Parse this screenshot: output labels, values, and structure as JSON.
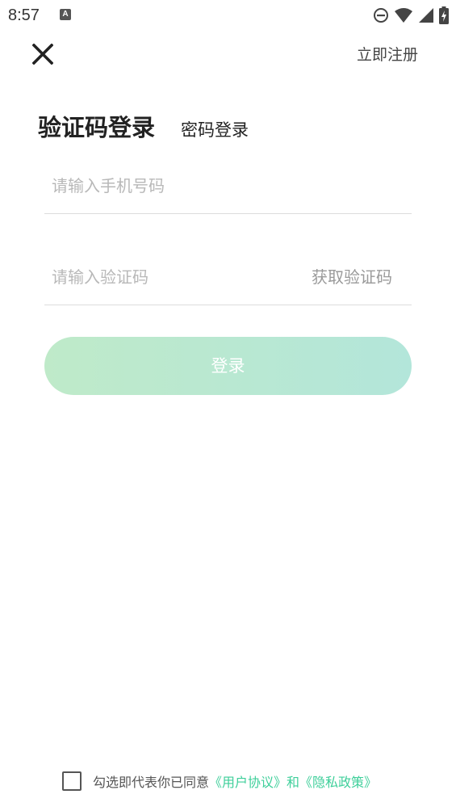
{
  "status_bar": {
    "time": "8:57",
    "app_icon": "A",
    "icons": [
      "do-not-disturb-icon",
      "wifi-icon",
      "cell-signal-icon",
      "battery-charging-icon"
    ]
  },
  "header": {
    "close_icon": "close-icon",
    "register_label": "立即注册"
  },
  "tabs": {
    "sms_login": "验证码登录",
    "password_login": "密码登录"
  },
  "form": {
    "phone_placeholder": "请输入手机号码",
    "phone_value": "",
    "code_placeholder": "请输入验证码",
    "code_value": "",
    "get_code_label": "获取验证码",
    "login_label": "登录"
  },
  "agreement": {
    "checked": false,
    "prefix": "勾选即代表你已同意",
    "user_agreement": "《用户协议》",
    "and": "和",
    "privacy_policy": "《隐私政策》"
  },
  "colors": {
    "accent": "#3ecf9a",
    "button_gradient_start": "#bfeac9",
    "button_gradient_end": "#b3e6da"
  }
}
